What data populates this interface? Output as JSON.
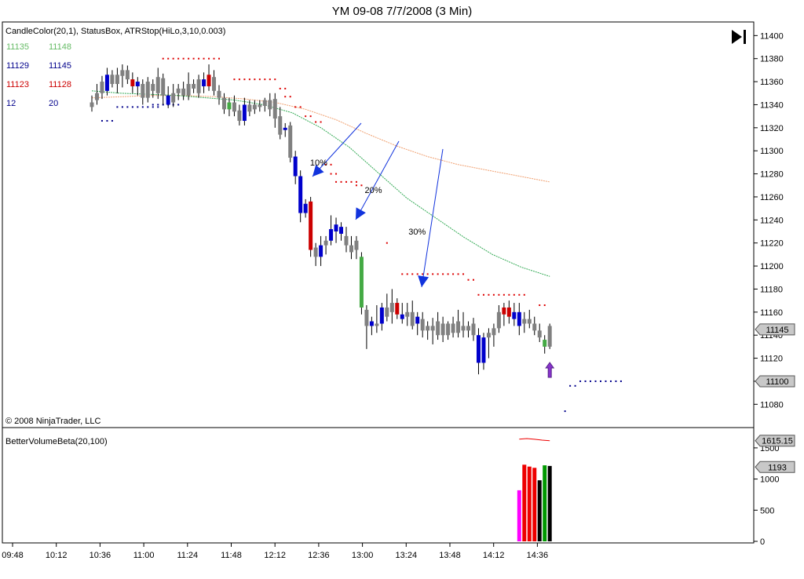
{
  "title": "YM 09-08  7/7/2008 (3 Min)",
  "indicator_label": "CandleColor(20,1), StatusBox, ATRStop(HiLo,3,10,0.003)",
  "copyright": "© 2008 NinjaTrader, LLC",
  "volume_label": "BetterVolumeBeta(20,100)",
  "play_icon": "skip-to-end-icon",
  "status_box": [
    {
      "left": "11135",
      "right": "11148",
      "color": "#66bb66"
    },
    {
      "left": "11129",
      "right": "11145",
      "color": "#00008b"
    },
    {
      "left": "11123",
      "right": "11128",
      "color": "#cc0000"
    },
    {
      "left": "12",
      "right": "20",
      "color": "#00008b"
    }
  ],
  "annotations": [
    {
      "text": "10%",
      "x_label": "12:36",
      "price": 11290
    },
    {
      "text": "20%",
      "x_label": "13:06",
      "price": 11266
    },
    {
      "text": "30%",
      "x_label": "13:30",
      "price": 11230
    }
  ],
  "colors": {
    "up": "#0000cc",
    "down": "#cc0000",
    "neutral": "#808080",
    "climax": "#44aa44",
    "ema_fast": "#33aa55",
    "ema_slow": "#f0a070",
    "stop_up": "#00008b",
    "stop_down": "#dd0000",
    "volume_pink": "#ff00ff",
    "volume_red": "#ee0000",
    "volume_green": "#009900",
    "volume_black": "#000000"
  },
  "chart_data": [
    {
      "type": "candlestick",
      "name": "YM 09-08",
      "x_ticks": [
        "09:48",
        "10:12",
        "10:36",
        "11:00",
        "11:24",
        "11:48",
        "12:12",
        "12:36",
        "13:00",
        "13:24",
        "13:48",
        "14:12",
        "14:36"
      ],
      "y_ticks": [
        11080,
        11100,
        11120,
        11140,
        11160,
        11180,
        11200,
        11220,
        11240,
        11260,
        11280,
        11300,
        11320,
        11340,
        11360,
        11380,
        11400
      ],
      "ylim": [
        11070,
        11405
      ],
      "last_price": "11145",
      "stop_price": "11100",
      "candles_ohlc_color": [
        [
          11342,
          11348,
          11334,
          11338,
          "neutral"
        ],
        [
          11344,
          11358,
          11340,
          11350,
          "neutral"
        ],
        [
          11350,
          11365,
          11345,
          11360,
          "neutral"
        ],
        [
          11352,
          11372,
          11348,
          11366,
          "up"
        ],
        [
          11366,
          11370,
          11355,
          11358,
          "neutral"
        ],
        [
          11358,
          11372,
          11350,
          11366,
          "neutral"
        ],
        [
          11365,
          11375,
          11355,
          11370,
          "neutral"
        ],
        [
          11370,
          11374,
          11358,
          11362,
          "neutral"
        ],
        [
          11362,
          11368,
          11350,
          11356,
          "down"
        ],
        [
          11356,
          11364,
          11348,
          11360,
          "up"
        ],
        [
          11358,
          11362,
          11340,
          11346,
          "neutral"
        ],
        [
          11346,
          11364,
          11342,
          11360,
          "neutral"
        ],
        [
          11358,
          11362,
          11346,
          11352,
          "neutral"
        ],
        [
          11350,
          11372,
          11345,
          11364,
          "neutral"
        ],
        [
          11363,
          11367,
          11340,
          11348,
          "neutral"
        ],
        [
          11348,
          11356,
          11337,
          11340,
          "up"
        ],
        [
          11342,
          11358,
          11338,
          11350,
          "neutral"
        ],
        [
          11350,
          11358,
          11344,
          11354,
          "neutral"
        ],
        [
          11354,
          11360,
          11344,
          11348,
          "neutral"
        ],
        [
          11348,
          11368,
          11344,
          11358,
          "neutral"
        ],
        [
          11358,
          11362,
          11350,
          11354,
          "neutral"
        ],
        [
          11350,
          11366,
          11346,
          11362,
          "neutral"
        ],
        [
          11362,
          11368,
          11350,
          11356,
          "up"
        ],
        [
          11356,
          11375,
          11352,
          11366,
          "down"
        ],
        [
          11364,
          11370,
          11348,
          11352,
          "neutral"
        ],
        [
          11352,
          11357,
          11340,
          11346,
          "neutral"
        ],
        [
          11346,
          11350,
          11332,
          11336,
          "neutral"
        ],
        [
          11336,
          11346,
          11330,
          11342,
          "climax"
        ],
        [
          11342,
          11348,
          11330,
          11334,
          "neutral"
        ],
        [
          11335,
          11340,
          11322,
          11326,
          "neutral"
        ],
        [
          11326,
          11346,
          11322,
          11340,
          "up"
        ],
        [
          11340,
          11344,
          11330,
          11334,
          "neutral"
        ],
        [
          11336,
          11344,
          11332,
          11340,
          "neutral"
        ],
        [
          11340,
          11344,
          11334,
          11338,
          "neutral"
        ],
        [
          11339,
          11346,
          11334,
          11344,
          "neutral"
        ],
        [
          11344,
          11350,
          11330,
          11336,
          "neutral"
        ],
        [
          11345,
          11350,
          11320,
          11328,
          "neutral"
        ],
        [
          11330,
          11338,
          11310,
          11314,
          "neutral"
        ],
        [
          11318,
          11324,
          11312,
          11320,
          "up"
        ],
        [
          11322,
          11325,
          11290,
          11294,
          "neutral"
        ],
        [
          11295,
          11300,
          11271,
          11278,
          "up"
        ],
        [
          11278,
          11283,
          11238,
          11246,
          "up"
        ],
        [
          11246,
          11258,
          11242,
          11254,
          "up"
        ],
        [
          11256,
          11260,
          11208,
          11214,
          "down"
        ],
        [
          11216,
          11220,
          11200,
          11208,
          "neutral"
        ],
        [
          11208,
          11226,
          11200,
          11218,
          "up"
        ],
        [
          11218,
          11226,
          11210,
          11222,
          "neutral"
        ],
        [
          11222,
          11244,
          11218,
          11232,
          "up"
        ],
        [
          11230,
          11242,
          11220,
          11236,
          "up"
        ],
        [
          11234,
          11238,
          11222,
          11228,
          "up"
        ],
        [
          11226,
          11234,
          11212,
          11218,
          "neutral"
        ],
        [
          11218,
          11226,
          11206,
          11212,
          "neutral"
        ],
        [
          11222,
          11226,
          11206,
          11214,
          "neutral"
        ],
        [
          11208,
          11212,
          11158,
          11164,
          "climax"
        ],
        [
          11162,
          11166,
          11128,
          11148,
          "neutral"
        ],
        [
          11148,
          11156,
          11140,
          11152,
          "up"
        ],
        [
          11150,
          11166,
          11142,
          11148,
          "neutral"
        ],
        [
          11150,
          11168,
          11144,
          11164,
          "up"
        ],
        [
          11164,
          11176,
          11152,
          11156,
          "neutral"
        ],
        [
          11160,
          11180,
          11150,
          11168,
          "neutral"
        ],
        [
          11168,
          11172,
          11154,
          11158,
          "down"
        ],
        [
          11158,
          11168,
          11150,
          11154,
          "up"
        ],
        [
          11156,
          11168,
          11148,
          11160,
          "neutral"
        ],
        [
          11160,
          11170,
          11145,
          11148,
          "neutral"
        ],
        [
          11150,
          11160,
          11140,
          11156,
          "up"
        ],
        [
          11154,
          11160,
          11138,
          11144,
          "neutral"
        ],
        [
          11144,
          11152,
          11136,
          11148,
          "neutral"
        ],
        [
          11148,
          11155,
          11132,
          11144,
          "neutral"
        ],
        [
          11140,
          11160,
          11136,
          11152,
          "neutral"
        ],
        [
          11150,
          11156,
          11134,
          11140,
          "neutral"
        ],
        [
          11140,
          11152,
          11136,
          11150,
          "neutral"
        ],
        [
          11150,
          11156,
          11138,
          11142,
          "neutral"
        ],
        [
          11142,
          11162,
          11138,
          11152,
          "neutral"
        ],
        [
          11148,
          11160,
          11138,
          11144,
          "neutral"
        ],
        [
          11144,
          11152,
          11138,
          11148,
          "neutral"
        ],
        [
          11150,
          11155,
          11135,
          11140,
          "neutral"
        ],
        [
          11140,
          11146,
          11106,
          11116,
          "up"
        ],
        [
          11116,
          11142,
          11110,
          11138,
          "up"
        ],
        [
          11138,
          11146,
          11120,
          11142,
          "neutral"
        ],
        [
          11140,
          11150,
          11130,
          11146,
          "neutral"
        ],
        [
          11146,
          11166,
          11142,
          11160,
          "neutral"
        ],
        [
          11158,
          11168,
          11148,
          11164,
          "down"
        ],
        [
          11164,
          11170,
          11150,
          11156,
          "down"
        ],
        [
          11154,
          11168,
          11148,
          11160,
          "up"
        ],
        [
          11160,
          11168,
          11140,
          11148,
          "up"
        ],
        [
          11150,
          11160,
          11142,
          11154,
          "neutral"
        ],
        [
          11154,
          11162,
          11146,
          11150,
          "neutral"
        ],
        [
          11150,
          11156,
          11140,
          11144,
          "neutral"
        ],
        [
          11144,
          11150,
          11134,
          11138,
          "neutral"
        ],
        [
          11136,
          11140,
          11124,
          11130,
          "climax"
        ],
        [
          11130,
          11150,
          11128,
          11148,
          "neutral"
        ]
      ],
      "ema_fast": [
        11352,
        11350,
        11349,
        11348,
        11346,
        11344,
        11340,
        11333,
        11320,
        11303,
        11281,
        11259,
        11242,
        11225,
        11210,
        11199,
        11191
      ],
      "ema_slow": [
        11346,
        11347,
        11348,
        11348,
        11347,
        11345,
        11342,
        11336,
        11327,
        11315,
        11304,
        11295,
        11288,
        11283,
        11278,
        11273
      ],
      "atr_stop_segments": [
        {
          "side": "below",
          "from": 2,
          "to": 4,
          "price": 11326
        },
        {
          "side": "below",
          "from": 5,
          "to": 13,
          "price": 11338
        },
        {
          "side": "below",
          "from": 12,
          "to": 17,
          "price": 11340
        },
        {
          "side": "above",
          "from": 14,
          "to": 25,
          "price": 11380
        },
        {
          "side": "above",
          "from": 28,
          "to": 36,
          "price": 11362
        },
        {
          "side": "above",
          "from": 37,
          "to": 38,
          "price": 11354
        },
        {
          "side": "above",
          "from": 38,
          "to": 39,
          "price": 11347
        },
        {
          "side": "above",
          "from": 40,
          "to": 41,
          "price": 11338
        },
        {
          "side": "above",
          "from": 42,
          "to": 43,
          "price": 11330
        },
        {
          "side": "above",
          "from": 44,
          "to": 45,
          "price": 11325
        },
        {
          "side": "above",
          "from": 46,
          "to": 47,
          "price": 11288
        },
        {
          "side": "above",
          "from": 47,
          "to": 48,
          "price": 11280
        },
        {
          "side": "above",
          "from": 48,
          "to": 52,
          "price": 11273
        },
        {
          "side": "above",
          "from": 52,
          "to": 53,
          "price": 11270
        },
        {
          "side": "above",
          "from": 58,
          "to": 58,
          "price": 11220
        },
        {
          "side": "above",
          "from": 61,
          "to": 73,
          "price": 11193
        },
        {
          "side": "above",
          "from": 74,
          "to": 75,
          "price": 11188
        },
        {
          "side": "above",
          "from": 76,
          "to": 85,
          "price": 11175
        },
        {
          "side": "above",
          "from": 88,
          "to": 89,
          "price": 11166
        },
        {
          "side": "below",
          "from": 94,
          "to": 95,
          "price": 11096
        },
        {
          "side": "below",
          "from": 96,
          "to": 104,
          "price": 11100
        },
        {
          "side": "below",
          "from": 93,
          "to": 93,
          "price": 11074
        }
      ]
    },
    {
      "type": "bar",
      "name": "BetterVolumeBeta(20,100)",
      "y_ticks": [
        0,
        500,
        1000,
        1500
      ],
      "ylim": [
        0,
        1700
      ],
      "last_value": "1615.15",
      "current_value": "1193",
      "bars": [
        {
          "value": 820,
          "color": "volume_pink"
        },
        {
          "value": 1230,
          "color": "volume_red"
        },
        {
          "value": 1200,
          "color": "volume_red"
        },
        {
          "value": 1180,
          "color": "volume_red"
        },
        {
          "value": 980,
          "color": "volume_black"
        },
        {
          "value": 1220,
          "color": "volume_green"
        },
        {
          "value": 1210,
          "color": "volume_black"
        }
      ],
      "threshold_line": [
        1640,
        1650,
        1638,
        1625,
        1615
      ]
    }
  ]
}
